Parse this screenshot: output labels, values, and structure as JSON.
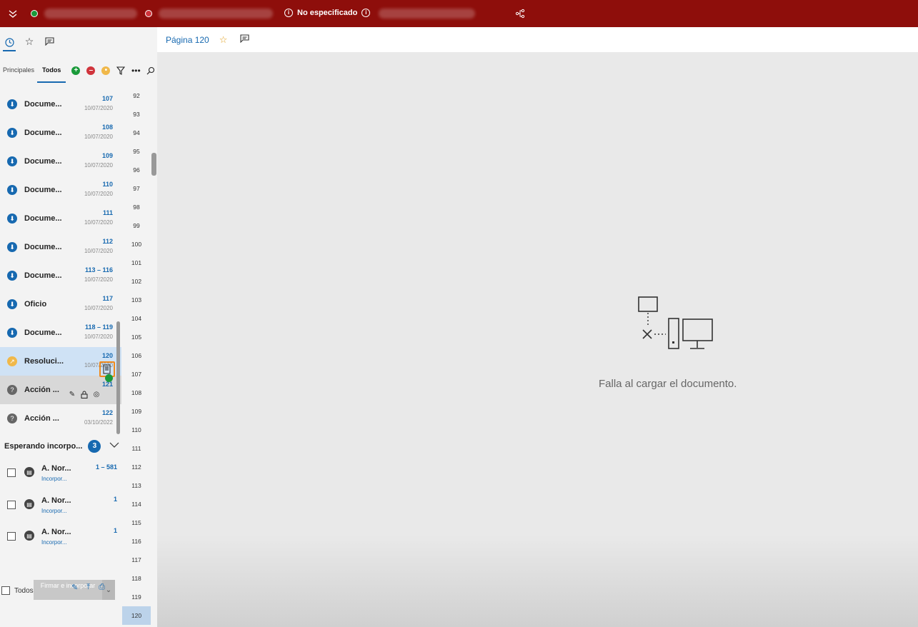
{
  "topbar": {
    "status": "No especificado",
    "icons": [
      "chevron-double-down-icon",
      "add-icon",
      "remove-icon",
      "info-icon",
      "share-icon"
    ]
  },
  "left_top_icons": [
    "clock-icon",
    "star-icon",
    "comment-icon"
  ],
  "tabs": {
    "principal": "Principales",
    "all": "Todos"
  },
  "docs": [
    {
      "label": "Docume...",
      "num": "107",
      "date": "10/07/2020"
    },
    {
      "label": "Docume...",
      "num": "108",
      "date": "10/07/2020"
    },
    {
      "label": "Docume...",
      "num": "109",
      "date": "10/07/2020"
    },
    {
      "label": "Docume...",
      "num": "110",
      "date": "10/07/2020"
    },
    {
      "label": "Docume...",
      "num": "111",
      "date": "10/07/2020"
    },
    {
      "label": "Docume...",
      "num": "112",
      "date": "10/07/2020"
    },
    {
      "label": "Docume...",
      "num": "113 – 116",
      "date": "10/07/2020"
    },
    {
      "label": "Oficio",
      "num": "117",
      "date": "10/07/2020"
    },
    {
      "label": "Docume...",
      "num": "118 – 119",
      "date": "10/07/2020"
    },
    {
      "label": "Resoluci...",
      "num": "120",
      "date": "10/07/2020"
    },
    {
      "label": "Acción ...",
      "num": "121",
      "date": ""
    },
    {
      "label": "Acción ...",
      "num": "122",
      "date": "03/10/2022"
    }
  ],
  "group": {
    "title": "Esperando incorpo...",
    "count": "3"
  },
  "pending": [
    {
      "label": "A. Nor...",
      "sub": "Incorpor...",
      "num": "1 – 581"
    },
    {
      "label": "A. Nor...",
      "sub": "Incorpor...",
      "num": "1"
    },
    {
      "label": "A. Nor...",
      "sub": "Incorpor...",
      "num": "1"
    }
  ],
  "bottom": {
    "all": "Todos",
    "sign": "Firmar e incorporar"
  },
  "pages": [
    "92",
    "93",
    "94",
    "95",
    "96",
    "97",
    "98",
    "99",
    "100",
    "101",
    "102",
    "103",
    "104",
    "105",
    "106",
    "107",
    "108",
    "109",
    "110",
    "111",
    "112",
    "113",
    "114",
    "115",
    "116",
    "117",
    "118",
    "119",
    "120"
  ],
  "main": {
    "page_title": "Página 120",
    "error": "Falla al cargar el documento."
  }
}
